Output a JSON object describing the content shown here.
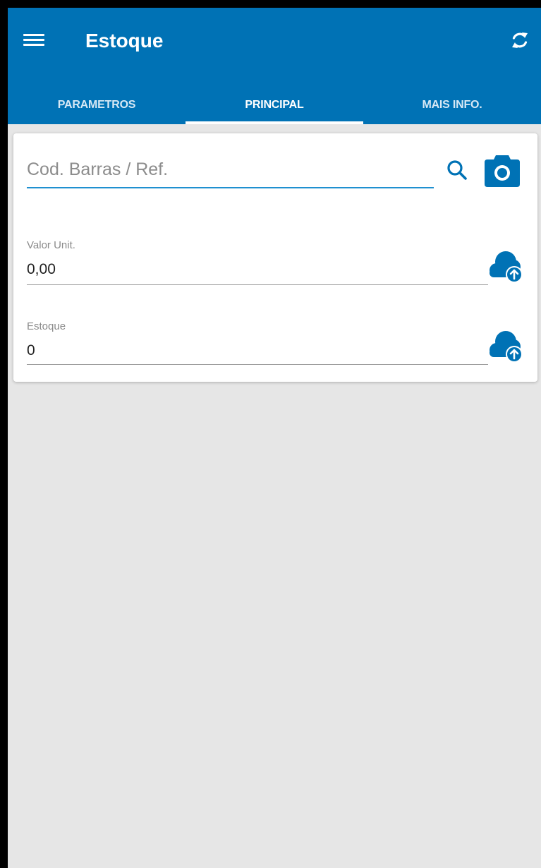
{
  "app": {
    "title": "Estoque",
    "accent_color": "#0072b5",
    "menu_icon": "menu-icon",
    "sync_icon": "sync-icon"
  },
  "tabs": [
    {
      "label": "PARAMETROS",
      "active": false
    },
    {
      "label": "PRINCIPAL",
      "active": true
    },
    {
      "label": "MAIS INFO.",
      "active": false
    }
  ],
  "search": {
    "placeholder": "Cod. Barras / Ref.",
    "value": "",
    "search_icon": "search-icon",
    "camera_icon": "camera-icon"
  },
  "fields": {
    "valor_unit": {
      "label": "Valor Unit.",
      "value": "0,00",
      "icon": "cloud-upload-icon"
    },
    "estoque": {
      "label": "Estoque",
      "value": "0",
      "icon": "cloud-upload-icon"
    }
  }
}
